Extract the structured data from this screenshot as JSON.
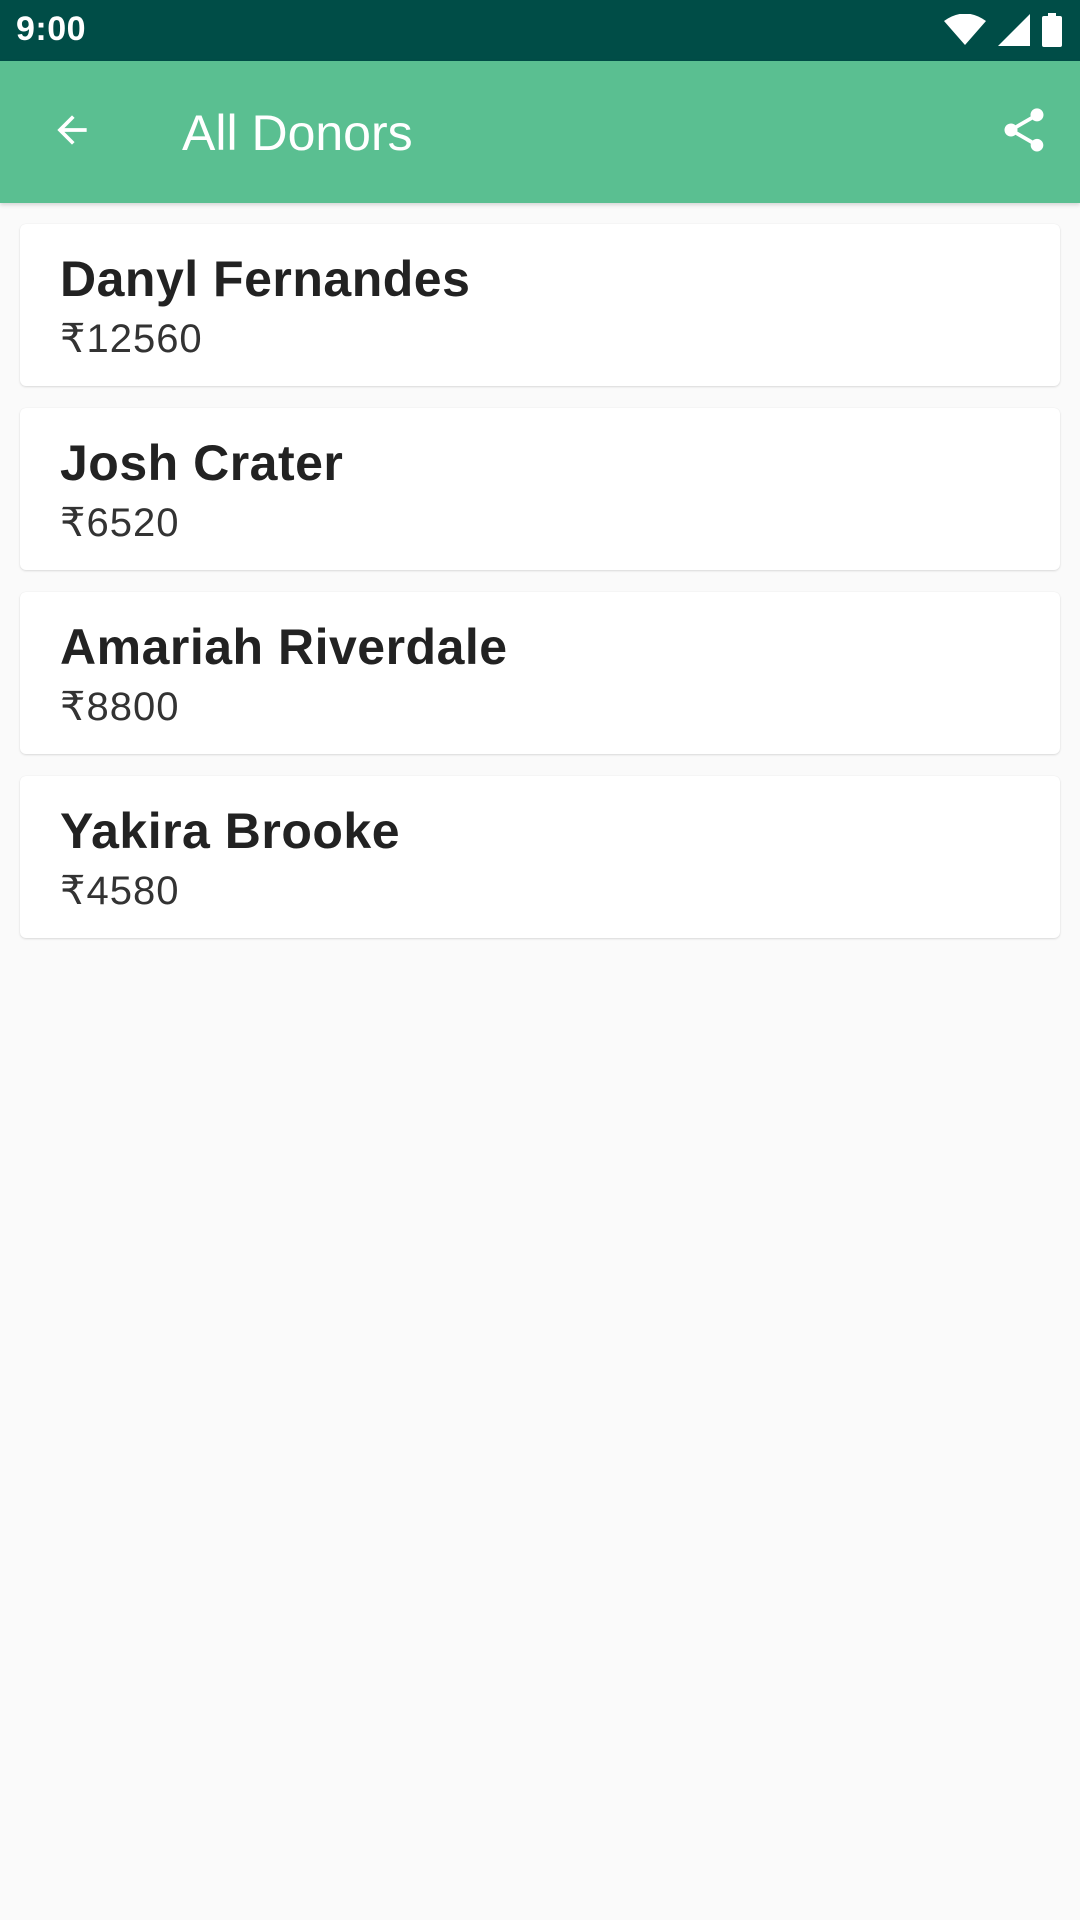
{
  "status_bar": {
    "time": "9:00",
    "icons": [
      "wifi-icon",
      "signal-icon",
      "battery-icon"
    ]
  },
  "app_bar": {
    "title": "All Donors",
    "back_icon": "arrow-back-icon",
    "share_icon": "share-icon"
  },
  "colors": {
    "status_bar": "#004d47",
    "app_bar": "#5abf91",
    "background": "#fafafa",
    "card": "#ffffff"
  },
  "donors": [
    {
      "name": "Danyl Fernandes",
      "amount": "₹12560"
    },
    {
      "name": "Josh Crater",
      "amount": "₹6520"
    },
    {
      "name": "Amariah Riverdale",
      "amount": "₹8800"
    },
    {
      "name": "Yakira Brooke",
      "amount": "₹4580"
    }
  ]
}
